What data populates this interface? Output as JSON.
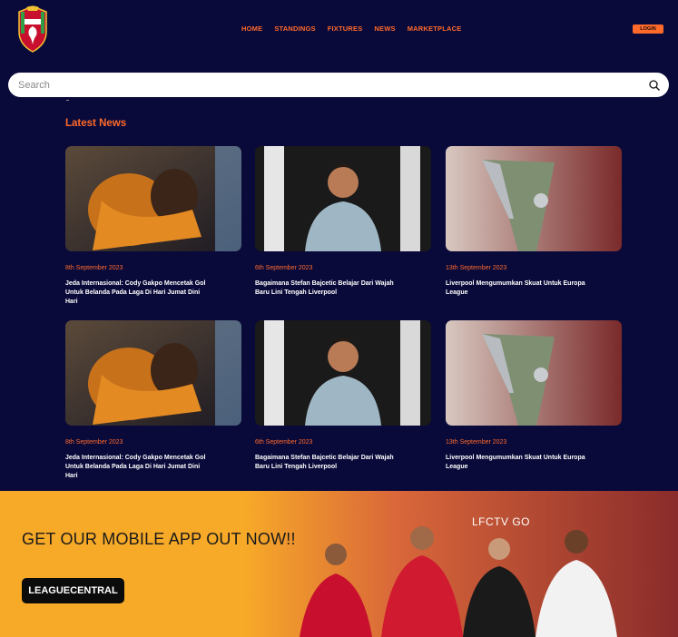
{
  "header": {
    "nav": [
      {
        "label": "HOME"
      },
      {
        "label": "STANDINGS"
      },
      {
        "label": "FIXTURES"
      },
      {
        "label": "NEWS"
      },
      {
        "label": "MARKETPLACE"
      }
    ],
    "login_label": "LOGIN"
  },
  "search": {
    "placeholder": "Search"
  },
  "latest": {
    "title": "Latest News",
    "cards": [
      {
        "date": "8th September 2023",
        "title": "Jeda Internasional: Cody Gakpo Mencetak Gol Untuk Belanda Pada Laga Di Hari Jumat Dini Hari",
        "image": "players-hugging"
      },
      {
        "date": "6th September 2023",
        "title": "Bagaimana Stefan Bajcetic Belajar Dari Wajah Baru Lini Tengah Liverpool",
        "image": "player-training"
      },
      {
        "date": "13th September 2023",
        "title": "Liverpool Mengumumkan Skuat Untuk Europa League",
        "image": "europa-trophy"
      },
      {
        "date": "8th September 2023",
        "title": "Jeda Internasional: Cody Gakpo Mencetak Gol Untuk Belanda Pada Laga Di Hari Jumat Dini Hari",
        "image": "players-hugging"
      },
      {
        "date": "6th September 2023",
        "title": "Bagaimana Stefan Bajcetic Belajar Dari Wajah Baru Lini Tengah Liverpool",
        "image": "player-training"
      },
      {
        "date": "13th September 2023",
        "title": "Liverpool Mengumumkan Skuat Untuk Europa League",
        "image": "europa-trophy"
      }
    ]
  },
  "banner": {
    "headline": "GET OUR MOBILE APP OUT NOW!!",
    "cta_label": "LEAGUECENTRAL",
    "brand": "LFCTV GO"
  },
  "colors": {
    "background": "#0a0a3a",
    "accent": "#ff6a2b",
    "banner": "#f7a928"
  }
}
